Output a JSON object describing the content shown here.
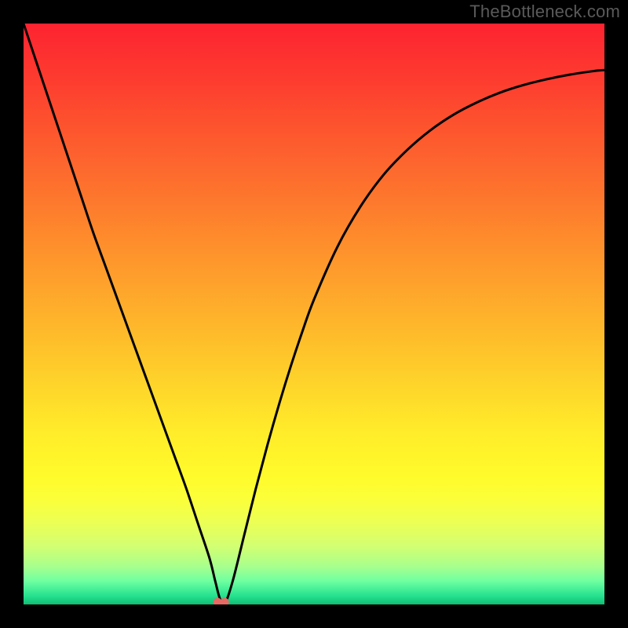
{
  "watermark": "TheBottleneck.com",
  "chart_data": {
    "type": "line",
    "title": "",
    "xlabel": "",
    "ylabel": "",
    "xlim": [
      0,
      100
    ],
    "ylim": [
      0,
      100
    ],
    "grid": false,
    "legend": false,
    "x": [
      0,
      2,
      4,
      6,
      8,
      10,
      12,
      14,
      16,
      18,
      20,
      22,
      24,
      26,
      28,
      30,
      32,
      33,
      33.8,
      34.6,
      36,
      38,
      40,
      42,
      44,
      46,
      48,
      50,
      54,
      58,
      62,
      66,
      70,
      74,
      78,
      82,
      86,
      90,
      94,
      98,
      100
    ],
    "y": [
      100,
      94,
      88,
      82,
      76,
      70,
      64,
      58.5,
      53,
      47.5,
      42,
      36.5,
      31,
      25.5,
      20,
      14,
      8,
      4,
      1,
      0,
      4,
      12,
      20,
      27.5,
      34.5,
      41,
      47,
      52.5,
      61.5,
      68.5,
      74,
      78.2,
      81.6,
      84.3,
      86.4,
      88.1,
      89.4,
      90.4,
      91.2,
      91.8,
      92
    ],
    "marker": {
      "x": 34.0,
      "y": 0.4,
      "color": "#e66a63",
      "shape": "double-dot"
    },
    "background_gradient": {
      "stops": [
        {
          "offset": 0.0,
          "color": "#fd2330"
        },
        {
          "offset": 0.1,
          "color": "#fd3d2f"
        },
        {
          "offset": 0.2,
          "color": "#fd5a2e"
        },
        {
          "offset": 0.3,
          "color": "#fd772d"
        },
        {
          "offset": 0.4,
          "color": "#fe942c"
        },
        {
          "offset": 0.5,
          "color": "#feb12b"
        },
        {
          "offset": 0.6,
          "color": "#fece2a"
        },
        {
          "offset": 0.7,
          "color": "#ffeb2a"
        },
        {
          "offset": 0.78,
          "color": "#fffb2b"
        },
        {
          "offset": 0.82,
          "color": "#fbff3a"
        },
        {
          "offset": 0.86,
          "color": "#ebff55"
        },
        {
          "offset": 0.9,
          "color": "#d2ff72"
        },
        {
          "offset": 0.935,
          "color": "#a7ff8d"
        },
        {
          "offset": 0.96,
          "color": "#6effa1"
        },
        {
          "offset": 0.985,
          "color": "#26e28f"
        },
        {
          "offset": 1.0,
          "color": "#0fbd74"
        }
      ]
    }
  }
}
